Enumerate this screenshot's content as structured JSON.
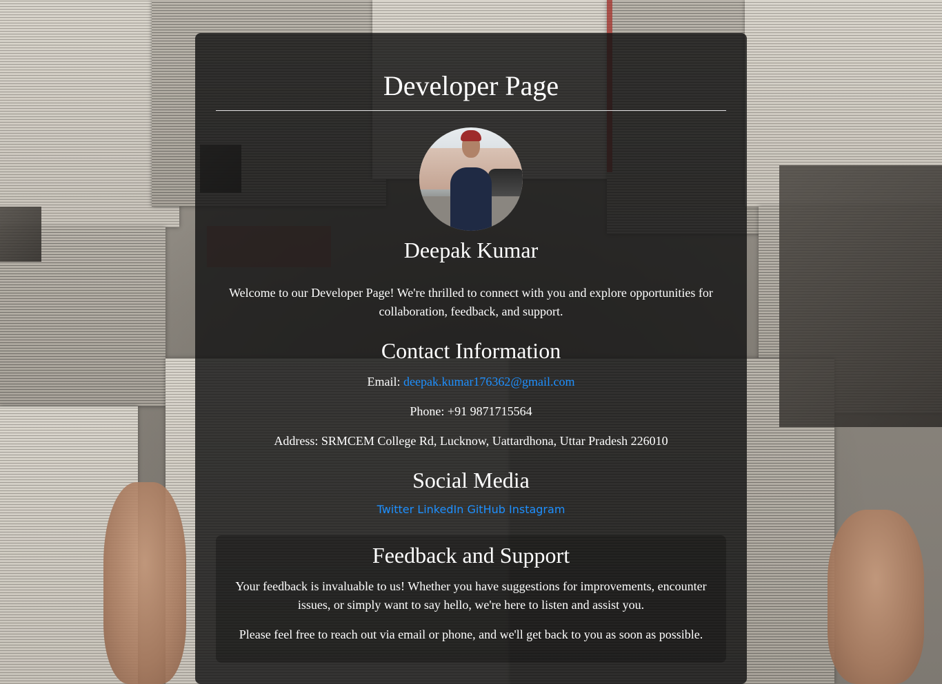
{
  "header": {
    "title": "Developer Page"
  },
  "profile": {
    "name": "Deepak Kumar",
    "avatar_icon": "profile-photo",
    "welcome": "Welcome to our Developer Page! We're thrilled to connect with you and explore opportunities for collaboration, feedback, and support."
  },
  "contact": {
    "title": "Contact Information",
    "email_label": "Email:",
    "email": "deepak.kumar176362@gmail.com",
    "phone_label": "Phone:",
    "phone": "+91 9871715564",
    "address_label": "Address:",
    "address": "SRMCEM College Rd, Lucknow, Uattardhona, Uttar Pradesh 226010"
  },
  "social": {
    "title": "Social Media",
    "links": [
      {
        "label": "Twitter"
      },
      {
        "label": "LinkedIn"
      },
      {
        "label": "GitHub"
      },
      {
        "label": "Instagram"
      }
    ]
  },
  "feedback": {
    "title": "Feedback and Support",
    "paragraph1": "Your feedback is invaluable to us! Whether you have suggestions for improvements, encounter issues, or simply want to say hello, we're here to listen and assist you.",
    "paragraph2": "Please feel free to reach out via email or phone, and we'll get back to you as soon as possible."
  },
  "colors": {
    "link": "#1e90ff",
    "card_background": "rgba(20,20,20,0.82)",
    "text": "#ffffff"
  }
}
